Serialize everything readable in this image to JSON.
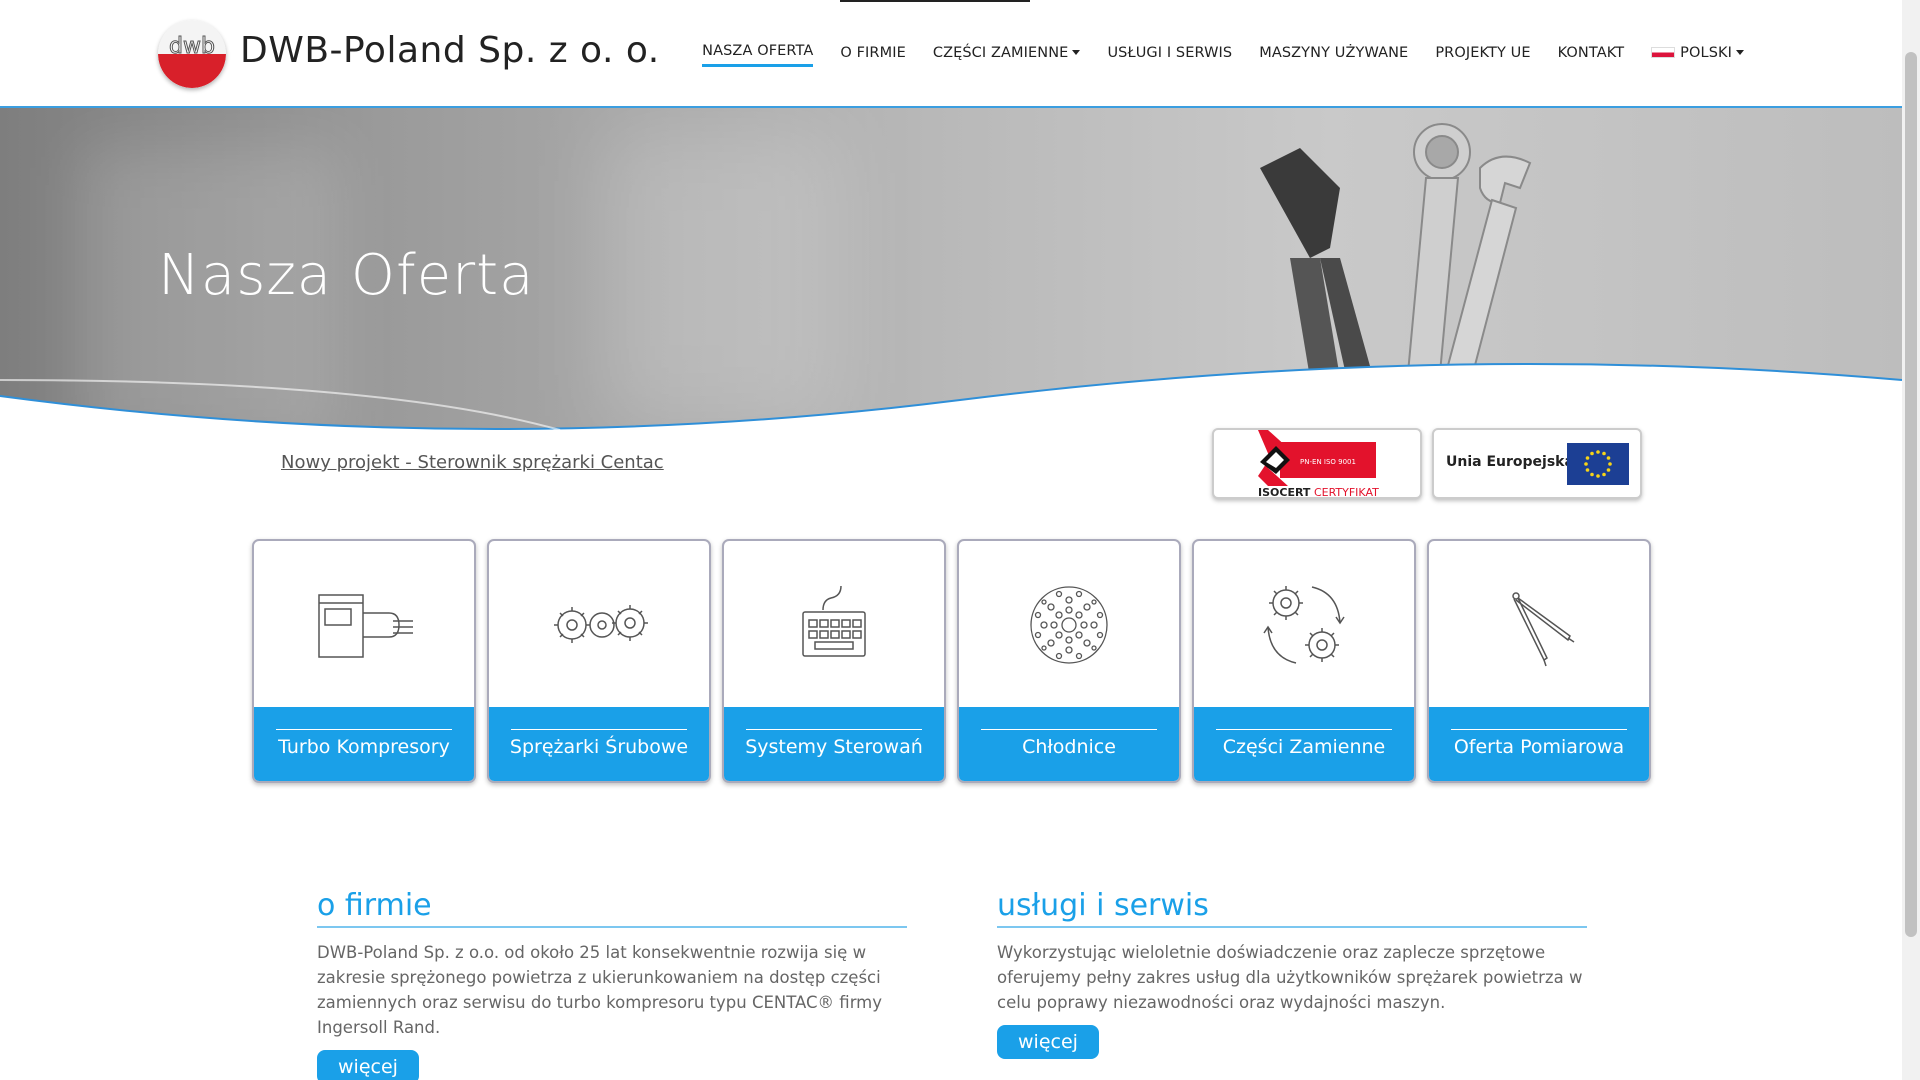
{
  "header": {
    "brand": "DWB-Poland Sp. z  o. o.",
    "logo_text": "dwb",
    "nav": [
      {
        "label": "NASZA OFERTA",
        "active": true
      },
      {
        "label": "O FIRMIE"
      },
      {
        "label": "CZĘŚCI ZAMIENNE",
        "dropdown": true
      },
      {
        "label": "USŁUGI I SERWIS"
      },
      {
        "label": "MASZYNY UŻYWANE"
      },
      {
        "label": "PROJEKTY UE"
      },
      {
        "label": "KONTAKT"
      },
      {
        "label": "POLSKI",
        "dropdown": true,
        "flag": "pl-flag-icon"
      }
    ]
  },
  "hero": {
    "title": "Nasza Oferta"
  },
  "project_link": "Nowy projekt - Sterownik sprężarki Centac",
  "badges": {
    "iso_small": "PN-EN ISO 9001",
    "iso_label": "ISOCERT",
    "iso_label_red": "CERTYFIKAT",
    "eu_label": "Unia Europejska"
  },
  "cards": [
    {
      "label": "Turbo Kompresory",
      "icon": "turbo-compressor-icon"
    },
    {
      "label": "Sprężarki Śrubowe",
      "icon": "gears-icon"
    },
    {
      "label": "Systemy Sterowań",
      "icon": "keyboard-icon"
    },
    {
      "label": "Chłodnice",
      "icon": "cooler-icon"
    },
    {
      "label": "Części Zamienne",
      "icon": "gear-cycle-icon"
    },
    {
      "label": "Oferta Pomiarowa",
      "icon": "compass-icon"
    }
  ],
  "sections": {
    "about": {
      "title": "o firmie",
      "text": "DWB-Poland Sp. z o.o. od około 25 lat konsekwentnie rozwija się w zakresie sprężonego powietrza z ukierunkowaniem na dostęp części zamiennych oraz serwisu do turbo kompresoru typu CENTAC® firmy Ingersoll Rand.",
      "button": "więcej"
    },
    "services": {
      "title": "usługi i serwis",
      "text": "Wykorzystując wieloletnie doświadczenie oraz zaplecze sprzętowe oferujemy pełny zakres usług dla użytkowników sprężarek powietrza w celu poprawy niezawodności oraz wydajności maszyn.",
      "button": "więcej"
    }
  },
  "colors": {
    "accent": "#1aa0e8",
    "logo_red": "#d8202a"
  }
}
